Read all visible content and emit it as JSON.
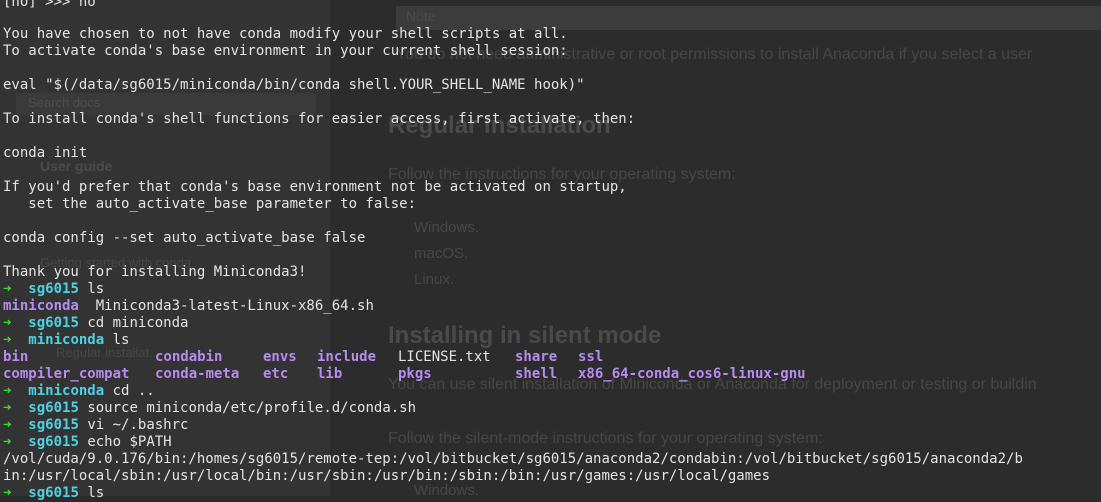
{
  "background_docs": {
    "note_label": "Note",
    "partial_line": "You do not need administrative or root permissions to install Anaconda if you select a user",
    "search_placeholder": "Search docs",
    "heading_regular": "Regular installation",
    "follow_os": "Follow the instructions for your operating system:",
    "os_list": [
      "Windows.",
      "macOS.",
      "Linux."
    ],
    "heading_silent": "Installing in silent mode",
    "silent_desc": "You can use silent installation of Miniconda or Anaconda for deployment or testing or buildin",
    "follow_silent": "Follow the silent-mode instructions for your operating system:",
    "os_list_2": [
      "Windows."
    ],
    "sidebar_user_guide": "User guide",
    "sidebar_getting_started": "Getting started with conda",
    "sidebar_regular_install": "Regular installat..."
  },
  "terminal": {
    "line_prompt_no": "[no] >>> no",
    "line_chosen": "You have chosen to not have conda modify your shell scripts at all.",
    "line_activate": "To activate conda's base environment in your current shell session:",
    "line_eval": "eval \"$(/data/sg6015/miniconda/bin/conda shell.YOUR_SHELL_NAME hook)\"",
    "line_install_fn": "To install conda's shell functions for easier access, first activate, then:",
    "line_conda_init": "conda init",
    "line_prefer": "If you'd prefer that conda's base environment not be activated on startup,",
    "line_set_auto": "   set the auto_activate_base parameter to false:",
    "line_config": "conda config --set auto_activate_base false",
    "line_thanks": "Thank you for installing Miniconda3!",
    "prompt_arrow": "➜",
    "commands": [
      {
        "dir": "sg6015",
        "cmd": "ls"
      },
      {
        "dir": "sg6015",
        "cmd": "cd miniconda"
      },
      {
        "dir": "miniconda",
        "cmd": "ls"
      },
      {
        "dir": "miniconda",
        "cmd": "cd .."
      },
      {
        "dir": "sg6015",
        "cmd": "source miniconda/etc/profile.d/conda.sh"
      },
      {
        "dir": "sg6015",
        "cmd": "vi ~/.bashrc"
      },
      {
        "dir": "sg6015",
        "cmd": "echo $PATH"
      },
      {
        "dir": "sg6015",
        "cmd": "ls"
      }
    ],
    "ls_home": {
      "folder": "miniconda",
      "file": "Miniconda3-latest-Linux-x86_64.sh"
    },
    "ls_miniconda_row1": [
      {
        "name": "bin",
        "type": "dir"
      },
      {
        "name": "condabin",
        "type": "dir"
      },
      {
        "name": "envs",
        "type": "dir"
      },
      {
        "name": "include",
        "type": "dir"
      },
      {
        "name": "LICENSE.txt",
        "type": "file"
      },
      {
        "name": "share",
        "type": "dir"
      },
      {
        "name": "ssl",
        "type": "dir"
      }
    ],
    "ls_miniconda_row2": [
      {
        "name": "compiler_compat",
        "type": "dir"
      },
      {
        "name": "conda-meta",
        "type": "dir"
      },
      {
        "name": "etc",
        "type": "dir"
      },
      {
        "name": "lib",
        "type": "dir"
      },
      {
        "name": "pkgs",
        "type": "dir"
      },
      {
        "name": "shell",
        "type": "dir"
      },
      {
        "name": "x86_64-conda_cos6-linux-gnu",
        "type": "dir"
      }
    ],
    "path_line1": "/vol/cuda/9.0.176/bin:/homes/sg6015/remote-tep:/vol/bitbucket/sg6015/anaconda2/condabin:/vol/bitbucket/sg6015/anaconda2/b",
    "path_line2": "in:/usr/local/sbin:/usr/local/bin:/usr/sbin:/usr/bin:/sbin:/bin:/usr/games:/usr/local/games"
  },
  "colors": {
    "prompt_arrow": "#3fd93f",
    "prompt_dir": "#4fd1e0",
    "folder": "#b58cf0",
    "text": "#e4e4e4",
    "background": "#2b2b2b"
  }
}
